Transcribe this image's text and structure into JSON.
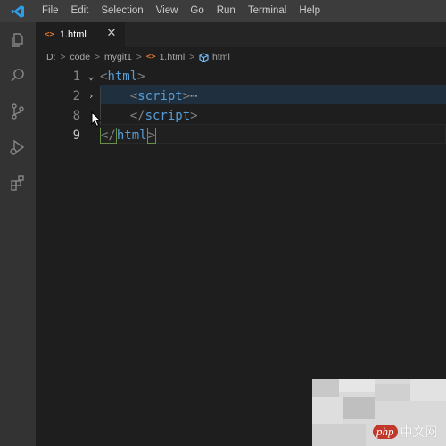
{
  "menu": {
    "items": [
      "File",
      "Edit",
      "Selection",
      "View",
      "Go",
      "Run",
      "Terminal",
      "Help"
    ]
  },
  "activity_bar": {
    "icons": [
      "explorer-icon",
      "search-icon",
      "source-control-icon",
      "run-debug-icon",
      "extensions-icon"
    ]
  },
  "tab": {
    "icon_text": "<>",
    "label": "1.html",
    "close": "✕"
  },
  "breadcrumb": {
    "parts": [
      "D:",
      "code",
      "mygit1",
      "1.html",
      "html"
    ],
    "file_icon_text": "<>"
  },
  "editor": {
    "lines": [
      {
        "number": "1",
        "fold": "⌄",
        "text_open": "<",
        "tag": "html",
        "text_close": ">"
      },
      {
        "number": "2",
        "fold": "›",
        "indent": "    ",
        "text_open": "<",
        "tag": "script",
        "text_close": ">",
        "ellipsis": "⋯"
      },
      {
        "number": "8",
        "fold": "",
        "indent": "    ",
        "text_open": "</",
        "tag": "script",
        "text_close": ">"
      },
      {
        "number": "9",
        "fold": "",
        "text_open": "</",
        "tag": "html",
        "text_close": ">"
      }
    ]
  },
  "watermark": {
    "badge": "php",
    "text": "中文网"
  },
  "colors": {
    "tag": "#569cd6",
    "punct": "#808080",
    "file_icon": "#e37933",
    "titlebar": "#3c3c3c",
    "activitybar": "#333333",
    "editor_bg": "#1e1e1e"
  }
}
